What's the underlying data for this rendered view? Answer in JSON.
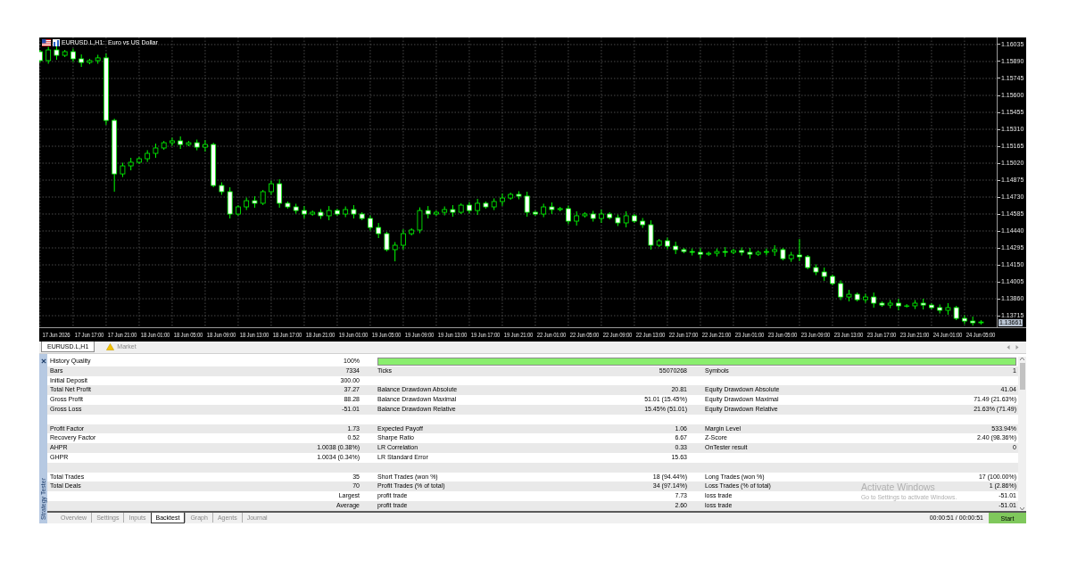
{
  "chart": {
    "chart_data": {
      "type": "candlestick",
      "title": "EURUSD.L,H1:  Euro vs US Dollar",
      "grid": true,
      "ylim": [
        1.13616,
        1.16096
      ],
      "yticks": [
        {
          "value": 1.16035,
          "label": "1.16035"
        },
        {
          "value": 1.1589,
          "label": "1.15890"
        },
        {
          "value": 1.15745,
          "label": "1.15745"
        },
        {
          "value": 1.156,
          "label": "1.15600"
        },
        {
          "value": 1.15455,
          "label": "1.15455"
        },
        {
          "value": 1.1531,
          "label": "1.15310"
        },
        {
          "value": 1.15165,
          "label": "1.15165"
        },
        {
          "value": 1.1502,
          "label": "1.15020"
        },
        {
          "value": 1.14875,
          "label": "1.14875"
        },
        {
          "value": 1.1473,
          "label": "1.14730"
        },
        {
          "value": 1.14585,
          "label": "1.14585"
        },
        {
          "value": 1.1444,
          "label": "1.14440"
        },
        {
          "value": 1.14295,
          "label": "1.14295"
        },
        {
          "value": 1.1415,
          "label": "1.14150"
        },
        {
          "value": 1.14005,
          "label": "1.14005"
        },
        {
          "value": 1.1386,
          "label": "1.13860"
        },
        {
          "value": 1.13715,
          "label": "1.13715"
        }
      ],
      "categories": [
        null,
        null,
        "17 Jun 2026",
        null,
        null,
        null,
        "17 Jun 17:00",
        null,
        null,
        null,
        "17 Jun 21:00",
        null,
        null,
        null,
        "18 Jun 01:00",
        null,
        null,
        null,
        "18 Jun 05:00",
        null,
        null,
        null,
        "18 Jun 09:00",
        null,
        null,
        null,
        "18 Jun 13:00",
        null,
        null,
        null,
        "18 Jun 17:00",
        null,
        null,
        null,
        "18 Jun 21:00",
        null,
        null,
        null,
        "19 Jun 01:00",
        null,
        null,
        null,
        "19 Jun 05:00",
        null,
        null,
        null,
        "19 Jun 09:00",
        null,
        null,
        null,
        "19 Jun 13:00",
        null,
        null,
        null,
        "19 Jun 17:00",
        null,
        null,
        null,
        "19 Jun 21:00",
        null,
        null,
        null,
        "22 Jun 01:00",
        null,
        null,
        null,
        "22 Jun 05:00",
        null,
        null,
        null,
        "22 Jun 09:00",
        null,
        null,
        null,
        "22 Jun 13:00",
        null,
        null,
        null,
        "22 Jun 17:00",
        null,
        null,
        null,
        "22 Jun 21:00",
        null,
        null,
        null,
        "23 Jun 01:00",
        null,
        null,
        null,
        "23 Jun 05:00",
        null,
        null,
        null,
        "23 Jun 09:00",
        null,
        null,
        null,
        "23 Jun 13:00",
        null,
        null,
        null,
        "23 Jun 17:00",
        null,
        null,
        null,
        "23 Jun 21:00",
        null,
        null,
        null,
        "24 Jun 01:00",
        null,
        null,
        null,
        "24 Jun 05:00"
      ],
      "series": [
        {
          "ohlc": [
            [
              1.15974,
              1.15989,
              1.15883,
              1.15898
            ],
            [
              1.15898,
              1.16016,
              1.15871,
              1.15989
            ],
            [
              1.15989,
              1.16027,
              1.15905,
              1.15943
            ],
            [
              1.15943,
              1.15989,
              1.15928,
              1.15974
            ],
            [
              1.15974,
              1.16001,
              1.15886,
              1.15913
            ],
            [
              1.15913,
              1.15951,
              1.15844,
              1.15882
            ],
            [
              1.15882,
              1.15913,
              1.15867,
              1.15898
            ],
            [
              1.15898,
              1.15948,
              1.15871,
              1.15921
            ],
            [
              1.15921,
              1.15959,
              1.15348,
              1.15386
            ],
            [
              1.15386,
              1.15401,
              1.14776,
              1.14928
            ],
            [
              1.14928,
              1.15024,
              1.14901,
              1.14997
            ],
            [
              1.14997,
              1.15066,
              1.14959,
              1.15028
            ],
            [
              1.15028,
              1.15073,
              1.15013,
              1.15058
            ],
            [
              1.15058,
              1.15131,
              1.15031,
              1.15104
            ],
            [
              1.15104,
              1.15188,
              1.15066,
              1.1515
            ],
            [
              1.1515,
              1.1521,
              1.15135,
              1.15195
            ],
            [
              1.15195,
              1.15238,
              1.15168,
              1.15211
            ],
            [
              1.15211,
              1.15249,
              1.15142,
              1.1518
            ],
            [
              1.1518,
              1.1521,
              1.15165,
              1.15195
            ],
            [
              1.15195,
              1.15222,
              1.1513,
              1.15157
            ],
            [
              1.15157,
              1.15218,
              1.15119,
              1.1518
            ],
            [
              1.1518,
              1.15195,
              1.14814,
              1.14829
            ],
            [
              1.14829,
              1.14856,
              1.14749,
              1.14776
            ],
            [
              1.14776,
              1.14814,
              1.14547,
              1.14585
            ],
            [
              1.14585,
              1.14661,
              1.1457,
              1.14646
            ],
            [
              1.14646,
              1.14726,
              1.14619,
              1.14699
            ],
            [
              1.14699,
              1.14737,
              1.14639,
              1.14677
            ],
            [
              1.14677,
              1.14791,
              1.14662,
              1.14776
            ],
            [
              1.14776,
              1.14871,
              1.14749,
              1.14844
            ],
            [
              1.14844,
              1.14882,
              1.14639,
              1.14677
            ],
            [
              1.14677,
              1.14692,
              1.14631,
              1.14646
            ],
            [
              1.14646,
              1.14673,
              1.14588,
              1.14615
            ],
            [
              1.14615,
              1.14653,
              1.14547,
              1.14585
            ],
            [
              1.14585,
              1.14615,
              1.1457,
              1.146
            ],
            [
              1.146,
              1.14627,
              1.14543,
              1.1457
            ],
            [
              1.1457,
              1.14653,
              1.14532,
              1.14615
            ],
            [
              1.14615,
              1.1463,
              1.1457,
              1.14585
            ],
            [
              1.14585,
              1.1465,
              1.14558,
              1.14623
            ],
            [
              1.14623,
              1.14661,
              1.14547,
              1.14585
            ],
            [
              1.14585,
              1.146,
              1.14532,
              1.14547
            ],
            [
              1.14547,
              1.14574,
              1.14443,
              1.1447
            ],
            [
              1.1447,
              1.14508,
              1.14379,
              1.14417
            ],
            [
              1.14417,
              1.14432,
              1.14265,
              1.1428
            ],
            [
              1.1428,
              1.14345,
              1.1418,
              1.14318
            ],
            [
              1.14318,
              1.14455,
              1.1428,
              1.14417
            ],
            [
              1.14417,
              1.14463,
              1.14402,
              1.14448
            ],
            [
              1.14448,
              1.14642,
              1.14421,
              1.14615
            ],
            [
              1.14615,
              1.14653,
              1.14547,
              1.14585
            ],
            [
              1.14585,
              1.14615,
              1.1457,
              1.146
            ],
            [
              1.146,
              1.1465,
              1.14573,
              1.14623
            ],
            [
              1.14623,
              1.14661,
              1.14562,
              1.146
            ],
            [
              1.146,
              1.14676,
              1.14585,
              1.14661
            ],
            [
              1.14661,
              1.14688,
              1.14588,
              1.14615
            ],
            [
              1.14615,
              1.14715,
              1.14577,
              1.14677
            ],
            [
              1.14677,
              1.14692,
              1.14631,
              1.14646
            ],
            [
              1.14646,
              1.14719,
              1.14619,
              1.14692
            ],
            [
              1.14692,
              1.1476,
              1.14654,
              1.14722
            ],
            [
              1.14722,
              1.14768,
              1.14707,
              1.14753
            ],
            [
              1.14753,
              1.1478,
              1.14711,
              1.14738
            ],
            [
              1.14738,
              1.14776,
              1.14562,
              1.146
            ],
            [
              1.146,
              1.14615,
              1.1457,
              1.14585
            ],
            [
              1.14585,
              1.14673,
              1.14558,
              1.14646
            ],
            [
              1.14646,
              1.14684,
              1.14585,
              1.14623
            ],
            [
              1.14623,
              1.14646,
              1.14608,
              1.14631
            ],
            [
              1.14631,
              1.14658,
              1.14497,
              1.14524
            ],
            [
              1.14524,
              1.14608,
              1.14486,
              1.1457
            ],
            [
              1.1457,
              1.146,
              1.14555,
              1.14585
            ],
            [
              1.14585,
              1.14612,
              1.1452,
              1.14547
            ],
            [
              1.14547,
              1.14623,
              1.14509,
              1.14585
            ],
            [
              1.14585,
              1.146,
              1.14539,
              1.14554
            ],
            [
              1.14554,
              1.14581,
              1.14482,
              1.14509
            ],
            [
              1.14509,
              1.14608,
              1.14471,
              1.1457
            ],
            [
              1.1457,
              1.14585,
              1.14509,
              1.14524
            ],
            [
              1.14524,
              1.14551,
              1.14466,
              1.14493
            ],
            [
              1.14493,
              1.14531,
              1.1428,
              1.14318
            ],
            [
              1.14318,
              1.14371,
              1.14303,
              1.14356
            ],
            [
              1.14356,
              1.14383,
              1.14283,
              1.1431
            ],
            [
              1.1431,
              1.14348,
              1.14242,
              1.1428
            ],
            [
              1.1428,
              1.14295,
              1.14249,
              1.14264
            ],
            [
              1.14264,
              1.14291,
              1.1423,
              1.14257
            ],
            [
              1.14257,
              1.14295,
              1.14203,
              1.14241
            ],
            [
              1.14241,
              1.14264,
              1.14226,
              1.14249
            ],
            [
              1.14249,
              1.14291,
              1.14222,
              1.14264
            ],
            [
              1.14264,
              1.14302,
              1.14219,
              1.14257
            ],
            [
              1.14257,
              1.14287,
              1.14242,
              1.14272
            ],
            [
              1.14272,
              1.14299,
              1.1423,
              1.14257
            ],
            [
              1.14257,
              1.14295,
              1.14203,
              1.14241
            ],
            [
              1.14241,
              1.14272,
              1.14226,
              1.14257
            ],
            [
              1.14257,
              1.14291,
              1.1423,
              1.14264
            ],
            [
              1.14264,
              1.14318,
              1.14226,
              1.1428
            ],
            [
              1.1428,
              1.14295,
              1.14188,
              1.14203
            ],
            [
              1.14203,
              1.14261,
              1.14176,
              1.14234
            ],
            [
              1.14234,
              1.14371,
              1.14181,
              1.14219
            ],
            [
              1.14219,
              1.14234,
              1.14112,
              1.14127
            ],
            [
              1.14127,
              1.14154,
              1.14062,
              1.14089
            ],
            [
              1.14089,
              1.14127,
              1.14013,
              1.14051
            ],
            [
              1.14051,
              1.14066,
              1.13975,
              1.1399
            ],
            [
              1.1399,
              1.14017,
              1.13848,
              1.13875
            ],
            [
              1.13875,
              1.13936,
              1.13837,
              1.13898
            ],
            [
              1.13898,
              1.13913,
              1.13837,
              1.13852
            ],
            [
              1.13852,
              1.13902,
              1.13825,
              1.13875
            ],
            [
              1.13875,
              1.13913,
              1.13784,
              1.13822
            ],
            [
              1.13822,
              1.13837,
              1.13791,
              1.13806
            ],
            [
              1.13806,
              1.13849,
              1.13779,
              1.13822
            ],
            [
              1.13822,
              1.1386,
              1.13761,
              1.13799
            ],
            [
              1.13799,
              1.13814,
              1.13784,
              1.13799
            ],
            [
              1.13799,
              1.13849,
              1.13772,
              1.13822
            ],
            [
              1.13822,
              1.1386,
              1.13768,
              1.13806
            ],
            [
              1.13806,
              1.13821,
              1.13769,
              1.13784
            ],
            [
              1.13784,
              1.13811,
              1.13734,
              1.13761
            ],
            [
              1.13761,
              1.13822,
              1.13723,
              1.13784
            ],
            [
              1.13784,
              1.13799,
              1.13677,
              1.13692
            ],
            [
              1.13692,
              1.13719,
              1.13642,
              1.13669
            ],
            [
              1.13669,
              1.13707,
              1.1363,
              1.13654
            ],
            [
              1.13654,
              1.13676,
              1.13639,
              1.13661
            ]
          ]
        }
      ]
    },
    "current_price": "1.13661"
  },
  "chart_tabs": [
    {
      "label": "EURUSD.L,H1",
      "kind": "chart",
      "selected": true
    },
    {
      "label": "Market",
      "kind": "market",
      "selected": false
    }
  ],
  "tester": {
    "title": "Strategy Tester",
    "rows": [
      {
        "kind": "stats",
        "cells": [
          {
            "kind": "stat",
            "label": "History Quality",
            "value": "100%"
          },
          {
            "kind": "progress",
            "level": 1
          }
        ]
      },
      {
        "kind": "stats",
        "cells": [
          {
            "kind": "stat",
            "label": "Bars",
            "value": "7334"
          },
          {
            "kind": "stat",
            "label": "Ticks",
            "value": "55070268"
          },
          {
            "kind": "stat",
            "label": "Symbols",
            "value": "1"
          }
        ]
      },
      {
        "kind": "stats",
        "cells": [
          {
            "kind": "stat",
            "label": "Initial Deposit",
            "value": "300.00"
          }
        ]
      },
      {
        "kind": "stats",
        "cells": [
          {
            "kind": "stat",
            "label": "Total Net Profit",
            "value": "37.27"
          },
          {
            "kind": "stat",
            "label": "Balance Drawdown Absolute",
            "value": "20.81"
          },
          {
            "kind": "stat",
            "label": "Equity Drawdown Absolute",
            "value": "41.04"
          }
        ]
      },
      {
        "kind": "stats",
        "cells": [
          {
            "kind": "stat",
            "label": "Gross Profit",
            "value": "88.28"
          },
          {
            "kind": "stat",
            "label": "Balance Drawdown Maximal",
            "value": "51.01 (15.45%)"
          },
          {
            "kind": "stat",
            "label": "Equity Drawdown Maximal",
            "value": "71.49 (21.63%)"
          }
        ]
      },
      {
        "kind": "stats",
        "cells": [
          {
            "kind": "stat",
            "label": "Gross Loss",
            "value": "-51.01"
          },
          {
            "kind": "stat",
            "label": "Balance Drawdown Relative",
            "value": "15.45% (51.01)"
          },
          {
            "kind": "stat",
            "label": "Equity Drawdown Relative",
            "value": "21.63% (71.49)"
          }
        ]
      },
      {
        "kind": "blank"
      },
      {
        "kind": "stats",
        "cells": [
          {
            "kind": "stat",
            "label": "Profit Factor",
            "value": "1.73"
          },
          {
            "kind": "stat",
            "label": "Expected Payoff",
            "value": "1.06"
          },
          {
            "kind": "stat",
            "label": "Margin Level",
            "value": "533.94%"
          }
        ]
      },
      {
        "kind": "stats",
        "cells": [
          {
            "kind": "stat",
            "label": "Recovery Factor",
            "value": "0.52"
          },
          {
            "kind": "stat",
            "label": "Sharpe Ratio",
            "value": "6.67"
          },
          {
            "kind": "stat",
            "label": "Z-Score",
            "value": "2.40 (98.36%)"
          }
        ]
      },
      {
        "kind": "stats",
        "cells": [
          {
            "kind": "stat",
            "label": "AHPR",
            "value": "1.0038 (0.38%)"
          },
          {
            "kind": "stat",
            "label": "LR Correlation",
            "value": "0.33"
          },
          {
            "kind": "stat",
            "label": "OnTester result",
            "value": "0"
          }
        ]
      },
      {
        "kind": "stats",
        "cells": [
          {
            "kind": "stat",
            "label": "GHPR",
            "value": "1.0034 (0.34%)"
          },
          {
            "kind": "stat",
            "label": "LR Standard Error",
            "value": "15.63"
          }
        ]
      },
      {
        "kind": "blank"
      },
      {
        "kind": "stats",
        "cells": [
          {
            "kind": "stat",
            "label": "Total Trades",
            "value": "35"
          },
          {
            "kind": "stat",
            "label": "Short Trades (won %)",
            "value": "18 (94.44%)"
          },
          {
            "kind": "stat",
            "label": "Long Trades (won %)",
            "value": "17 (100.00%)"
          }
        ]
      },
      {
        "kind": "stats",
        "cells": [
          {
            "kind": "stat",
            "label": "Total Deals",
            "value": "70"
          },
          {
            "kind": "stat",
            "label": "Profit Trades (% of total)",
            "value": "34 (97.14%)"
          },
          {
            "kind": "stat",
            "label": "Loss Trades (% of total)",
            "value": "1 (2.86%)"
          }
        ]
      },
      {
        "kind": "stats",
        "cells": [
          {
            "kind": "stat",
            "value": "Largest"
          },
          {
            "kind": "stat",
            "label": "profit trade",
            "value": "7.73"
          },
          {
            "kind": "stat",
            "label": "loss trade",
            "value": "-51.01"
          }
        ]
      },
      {
        "kind": "stats",
        "cells": [
          {
            "kind": "stat",
            "value": "Average"
          },
          {
            "kind": "stat",
            "label": "profit trade",
            "value": "2.60"
          },
          {
            "kind": "stat",
            "label": "loss trade",
            "value": "-51.01"
          }
        ]
      }
    ],
    "bottom_tabs": [
      {
        "label": "Overview",
        "selected": false
      },
      {
        "label": "Settings",
        "selected": false
      },
      {
        "label": "Inputs",
        "selected": false
      },
      {
        "label": "Backtest",
        "selected": true
      },
      {
        "label": "Graph",
        "selected": false
      },
      {
        "label": "Agents",
        "selected": false
      },
      {
        "label": "Journal",
        "selected": false
      }
    ],
    "elapsed": "00:00:51 / 00:00:51",
    "start_button": "Start"
  },
  "os_notice": {
    "title": "Activate Windows",
    "text": "Go to Settings to activate Windows."
  }
}
